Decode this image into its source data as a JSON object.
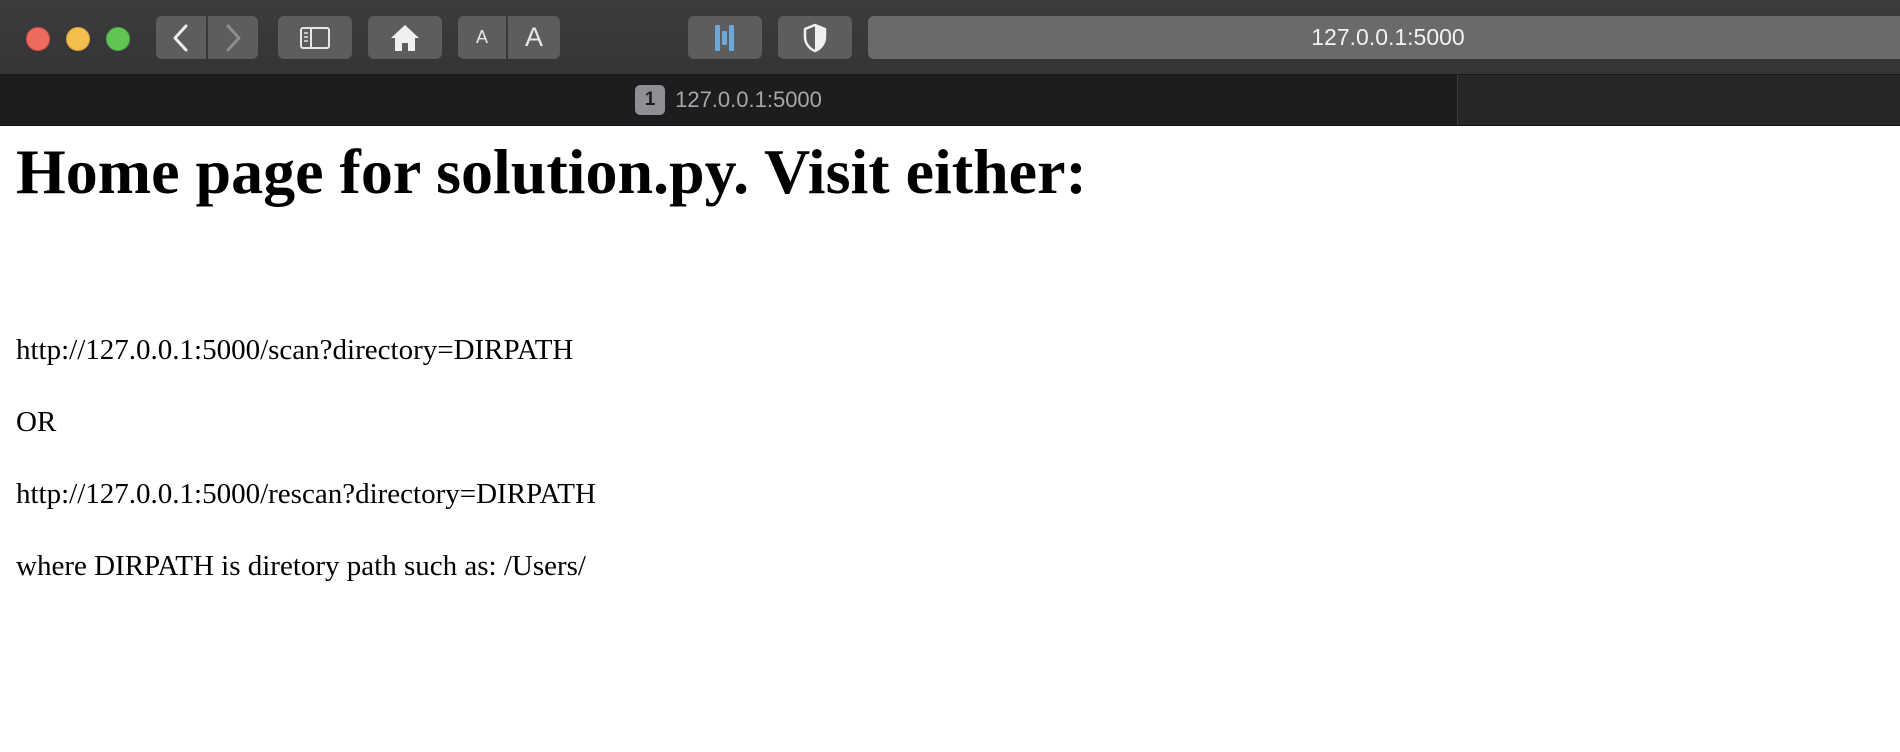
{
  "browser": {
    "toolbar": {
      "font_small_label": "A",
      "font_large_label": "A"
    },
    "address_bar": {
      "url": "127.0.0.1:5000"
    },
    "tabs": [
      {
        "badge": "1",
        "title": "127.0.0.1:5000"
      }
    ]
  },
  "page": {
    "heading": "Home page for solution.py. Visit either:",
    "paragraphs": [
      "http://127.0.0.1:5000/scan?directory=DIRPATH",
      "OR",
      "http://127.0.0.1:5000/rescan?directory=DIRPATH",
      "where DIRPATH is diretory path such as: /Users/"
    ]
  },
  "colors": {
    "toolbar_bg": "#3c3c3e",
    "close": "#ed6a5e",
    "minimize": "#f5bf4f",
    "maximize": "#61c554",
    "extension_accent": "#6ea8d8"
  },
  "icons": [
    "close-icon",
    "minimize-icon",
    "maximize-icon",
    "chevron-left-icon",
    "chevron-right-icon",
    "sidebar-icon",
    "home-icon",
    "extension-icon",
    "shield-icon"
  ]
}
